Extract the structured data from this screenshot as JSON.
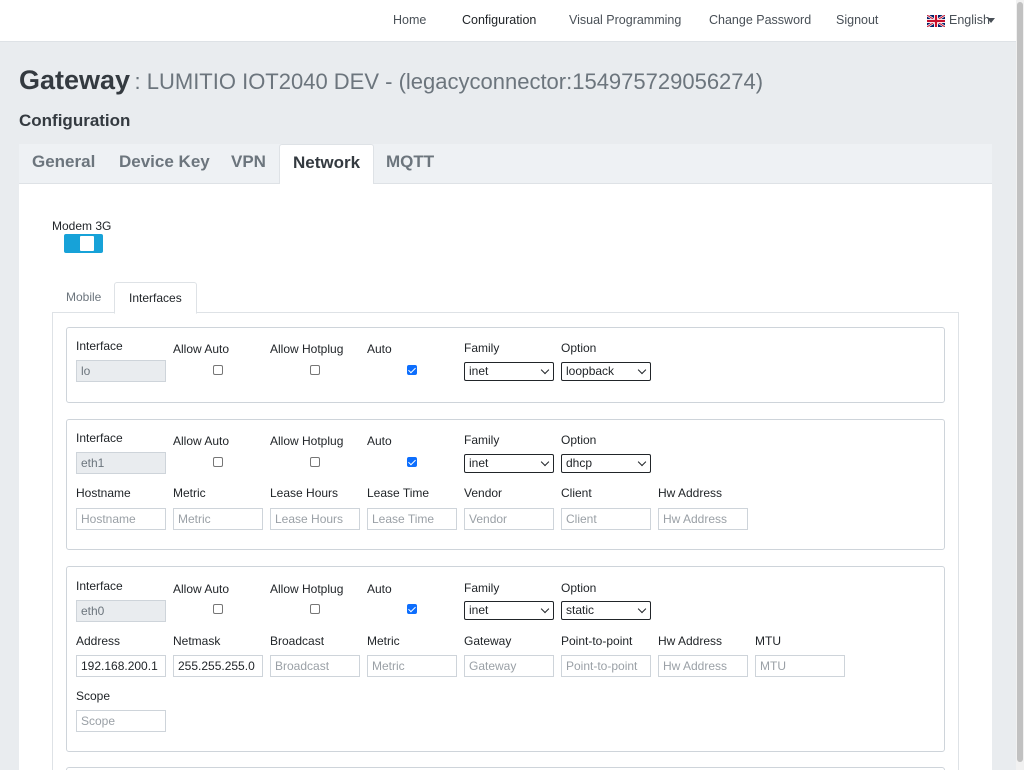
{
  "nav": {
    "items": [
      "Home",
      "Configuration",
      "Visual Programming",
      "Change Password",
      "Signout"
    ],
    "language": "English"
  },
  "header": {
    "title": "Gateway",
    "subtitle": ": LUMITIO IOT2040 DEV - (legacyconnector:154975729056274)",
    "section": "Configuration"
  },
  "tabs": [
    "General",
    "Device Key",
    "VPN",
    "Network",
    "MQTT"
  ],
  "active_tab": "Network",
  "modem": {
    "label": "Modem 3G",
    "enabled": true
  },
  "subtabs": [
    "Mobile",
    "Interfaces"
  ],
  "labels": {
    "interface": "Interface",
    "allow_auto": "Allow Auto",
    "allow_hotplug": "Allow Hotplug",
    "auto": "Auto",
    "family": "Family",
    "option": "Option",
    "hostname": "Hostname",
    "metric": "Metric",
    "lease_hours": "Lease Hours",
    "lease_time": "Lease Time",
    "vendor": "Vendor",
    "client": "Client",
    "hw_address": "Hw Address",
    "address": "Address",
    "netmask": "Netmask",
    "broadcast": "Broadcast",
    "gateway": "Gateway",
    "point_to_point": "Point-to-point",
    "mtu": "MTU",
    "scope": "Scope"
  },
  "interfaces": [
    {
      "name": "lo",
      "allow_auto": false,
      "allow_hotplug": false,
      "auto": true,
      "family": "inet",
      "option": "loopback"
    },
    {
      "name": "eth1",
      "allow_auto": false,
      "allow_hotplug": false,
      "auto": true,
      "family": "inet",
      "option": "dhcp"
    },
    {
      "name": "eth0",
      "allow_auto": false,
      "allow_hotplug": false,
      "auto": true,
      "family": "inet",
      "option": "static",
      "address": "192.168.200.1",
      "netmask": "255.255.255.0"
    }
  ],
  "colors": {
    "accent": "#17a2d8",
    "checkbox": "#0d6efd"
  }
}
